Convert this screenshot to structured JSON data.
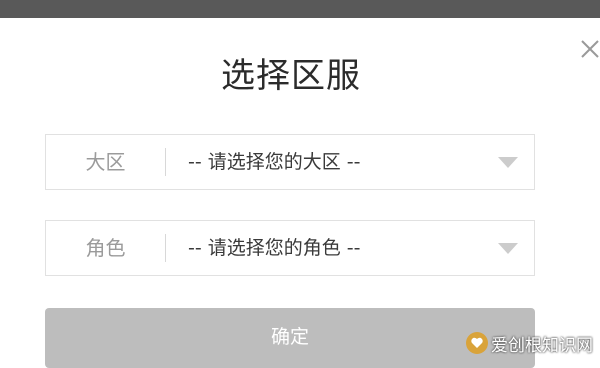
{
  "dialog": {
    "title": "选择区服",
    "close_icon": "close-icon"
  },
  "region_select": {
    "label": "大区",
    "value": "-- 请选择您的大区 --",
    "arrow_icon": "chevron-down-icon"
  },
  "role_select": {
    "label": "角色",
    "value": "-- 请选择您的角色 --",
    "arrow_icon": "chevron-down-icon"
  },
  "confirm_button": {
    "label": "确定"
  },
  "watermark": {
    "text": "爱创根知识网"
  },
  "colors": {
    "top_bar": "#595959",
    "confirm_disabled": "#bdbdbd",
    "border": "#e1e1e1",
    "arrow": "#cccccc"
  }
}
